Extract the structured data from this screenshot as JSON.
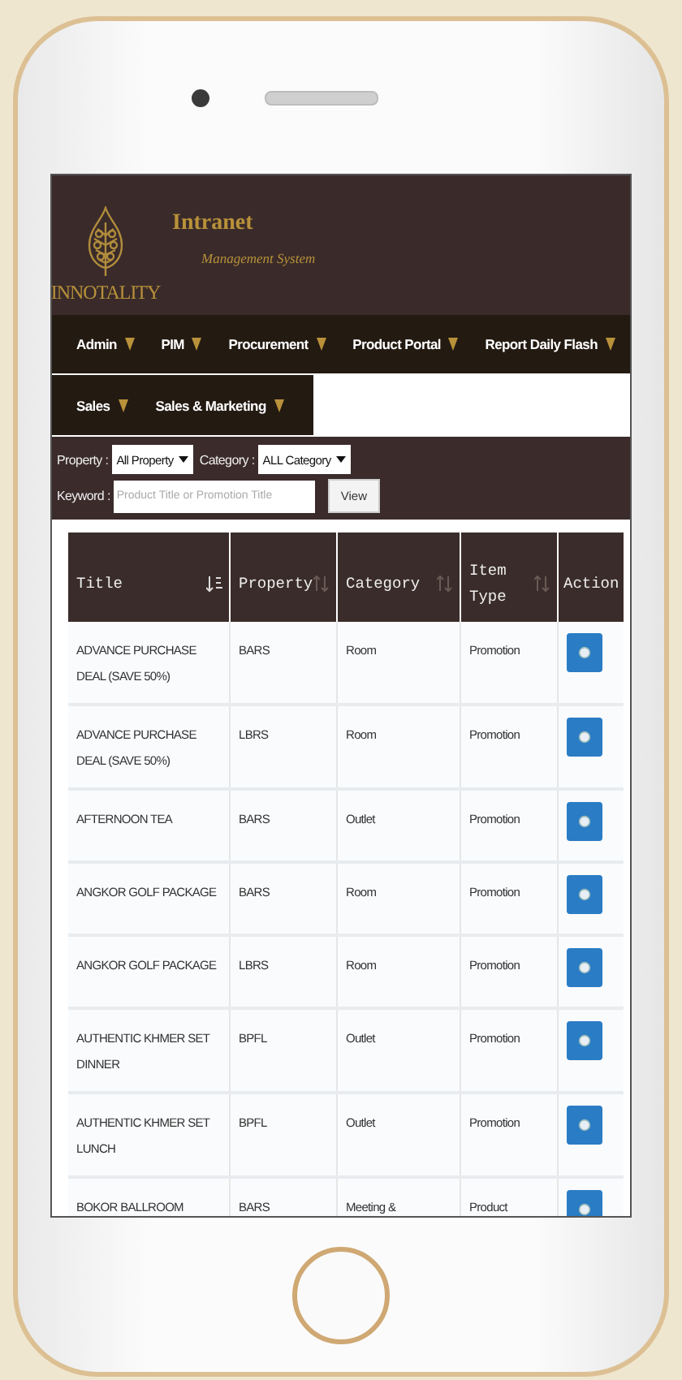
{
  "header": {
    "logo_text": "INNOTALITY",
    "title": "Intranet",
    "subtitle": "Management System"
  },
  "menu_rows": [
    [
      "Admin",
      "PIM",
      "Procurement",
      "Product Portal",
      "Report Daily Flash"
    ],
    [
      "Sales",
      "Sales & Marketing"
    ]
  ],
  "filters": {
    "property": {
      "label": "Property :",
      "value": "All Property"
    },
    "category": {
      "label": "Category :",
      "value": "ALL Category"
    },
    "keyword": {
      "label": "Keyword :",
      "placeholder": "Product Title or Promotion Title"
    },
    "view_button": "View"
  },
  "table": {
    "columns": [
      {
        "label": "Title",
        "sortable": true,
        "sorted": true
      },
      {
        "label": "Property",
        "sortable": true,
        "sorted": false
      },
      {
        "label": "Category",
        "sortable": true,
        "sorted": false
      },
      {
        "label": "Item Type",
        "sortable": true,
        "sorted": false
      },
      {
        "label": "Action",
        "sortable": false,
        "sorted": false
      }
    ],
    "rows": [
      {
        "title": "ADVANCE PURCHASE DEAL (SAVE 50%)",
        "property": "BARS",
        "category": "Room",
        "item_type": "Promotion"
      },
      {
        "title": "ADVANCE PURCHASE DEAL (SAVE 50%)",
        "property": "LBRS",
        "category": "Room",
        "item_type": "Promotion"
      },
      {
        "title": "AFTERNOON TEA",
        "property": "BARS",
        "category": "Outlet",
        "item_type": "Promotion"
      },
      {
        "title": "ANGKOR GOLF PACKAGE",
        "property": "BARS",
        "category": "Room",
        "item_type": "Promotion"
      },
      {
        "title": "ANGKOR GOLF PACKAGE",
        "property": "LBRS",
        "category": "Room",
        "item_type": "Promotion"
      },
      {
        "title": "AUTHENTIC KHMER SET DINNER",
        "property": "BPFL",
        "category": "Outlet",
        "item_type": "Promotion"
      },
      {
        "title": "AUTHENTIC KHMER SET LUNCH",
        "property": "BPFL",
        "category": "Outlet",
        "item_type": "Promotion"
      },
      {
        "title": "BOKOR BALLROOM",
        "property": "BARS",
        "category": "Meeting &",
        "item_type": "Product"
      }
    ]
  }
}
